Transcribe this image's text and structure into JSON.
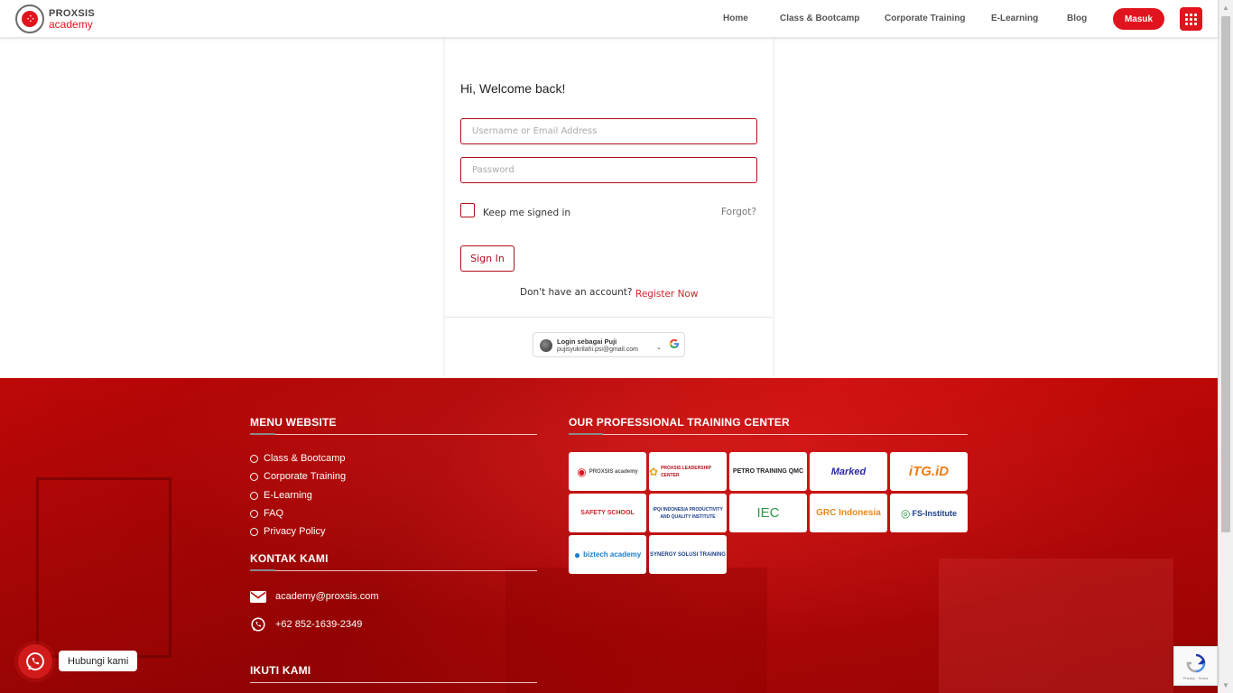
{
  "header": {
    "logo_line1": "PROXSIS",
    "logo_line2": "academy",
    "nav": [
      {
        "label": "Home"
      },
      {
        "label": "Class & Bootcamp"
      },
      {
        "label": "Corporate Training"
      },
      {
        "label": "E-Learning"
      },
      {
        "label": "Blog"
      }
    ],
    "login_label": "Masuk"
  },
  "login": {
    "welcome": "Hi, Welcome back!",
    "username_placeholder": "Username or Email Address",
    "password_placeholder": "Password",
    "keep_signed_in": "Keep me signed in",
    "forgot": "Forgot?",
    "sign_in": "Sign In",
    "no_account": "Don't have an account?",
    "register": "Register Now",
    "google": {
      "name": "Login sebagai Puji",
      "email": "pujisyukrilahi.psi@gmail.com"
    }
  },
  "footer": {
    "menu_title": "MENU WEBSITE",
    "menu_items": [
      {
        "label": "Class & Bootcamp"
      },
      {
        "label": "Corporate Training"
      },
      {
        "label": "E-Learning"
      },
      {
        "label": "FAQ"
      },
      {
        "label": "Privacy Policy"
      }
    ],
    "contact_title": "KONTAK KAMI",
    "email": "academy@proxsis.com",
    "phone": "+62 852-1639-2349",
    "follow_title": "IKUTI KAMI",
    "training_title": "OUR PROFESSIONAL TRAINING CENTER",
    "partners": [
      {
        "name": "PROXSIS academy"
      },
      {
        "name": "PROXSIS LEADERSHIP CENTER"
      },
      {
        "name": "PETRO TRAINING QMC"
      },
      {
        "name": "Marked"
      },
      {
        "name": "iTG.iD"
      },
      {
        "name": "SAFETY SCHOOL"
      },
      {
        "name": "IPQI INDONESIA PRODUCTIVITY AND QUALITY INSTITUTE"
      },
      {
        "name": "IEC"
      },
      {
        "name": "GRC Indonesia"
      },
      {
        "name": "FS-Institute"
      },
      {
        "name": "biztech academy"
      },
      {
        "name": "SYNERGY SOLUSI TRAINING"
      }
    ]
  },
  "whatsapp": {
    "label": "Hubungi kami"
  },
  "colors": {
    "brand_red": "#e0141e",
    "dark_red": "#b10e1a"
  }
}
